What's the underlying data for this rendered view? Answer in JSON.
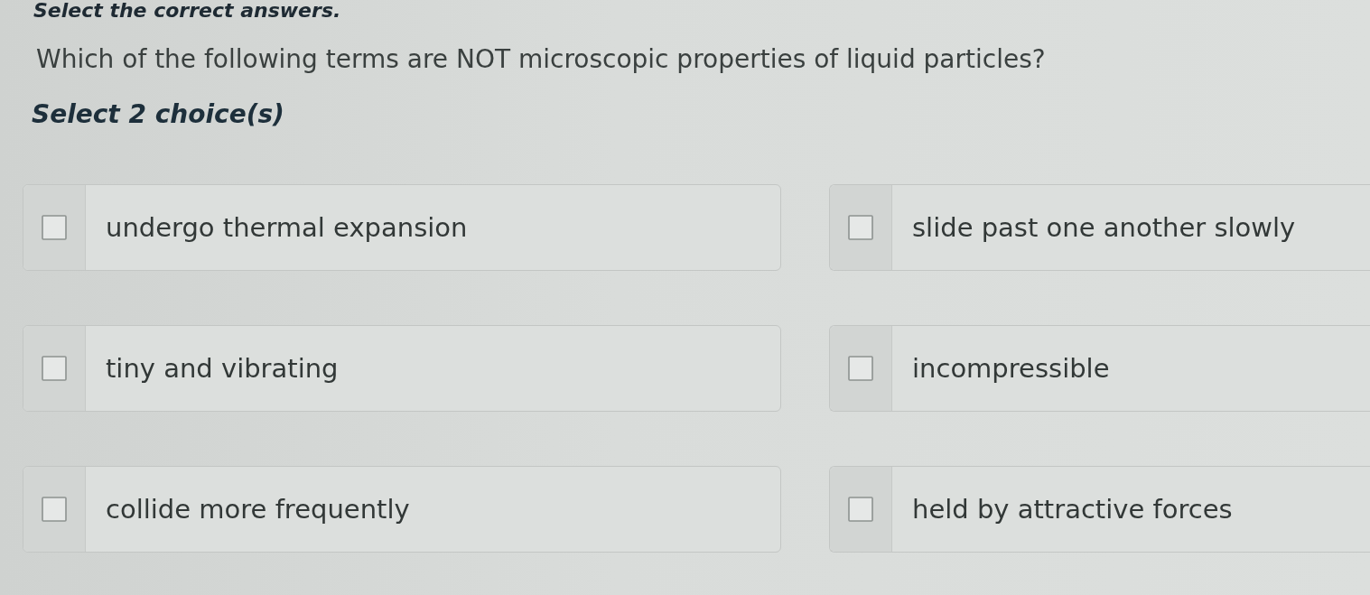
{
  "instructions": "Select the correct answers.",
  "question": "Which of the following terms are NOT microscopic properties of liquid particles?",
  "prompt": "Select 2 choice(s)",
  "choices": [
    {
      "label": "undergo thermal expansion",
      "checked": false
    },
    {
      "label": "slide past one another slowly",
      "checked": false
    },
    {
      "label": "tiny and vibrating",
      "checked": false
    },
    {
      "label": "incompressible",
      "checked": false
    },
    {
      "label": "collide more frequently",
      "checked": false
    },
    {
      "label": "held by attractive forces",
      "checked": false
    }
  ]
}
